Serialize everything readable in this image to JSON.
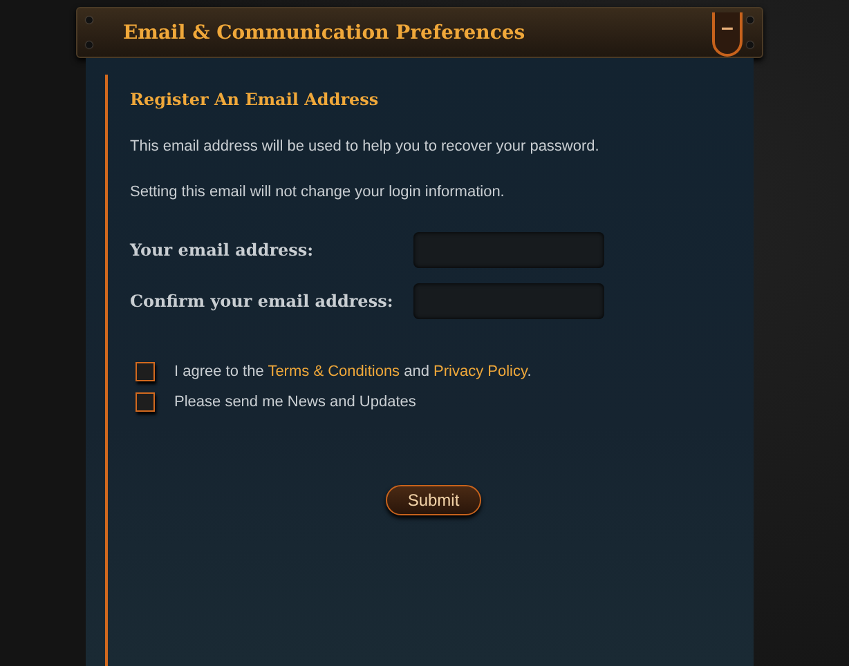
{
  "panel": {
    "title": "Email & Communication Preferences",
    "collapse_button": "–"
  },
  "section": {
    "heading": "Register An Email Address",
    "paragraphs": [
      "This email address will be used to help you to recover your password.",
      "Setting this email will not change your login information."
    ],
    "fields": [
      {
        "label": "Your email address:"
      },
      {
        "label": "Confirm your email address:"
      }
    ],
    "checkboxes": [
      {
        "checked": false,
        "segments": [
          {
            "text": "I agree to the ",
            "link": false
          },
          {
            "text": "Terms & Conditions",
            "link": true
          },
          {
            "text": " and ",
            "link": false
          },
          {
            "text": "Privacy Policy",
            "link": true
          },
          {
            "text": ".",
            "link": false
          }
        ]
      },
      {
        "checked": false,
        "segments": [
          {
            "text": "Please send me News and Updates",
            "link": false
          }
        ]
      }
    ],
    "submit": "Submit"
  }
}
